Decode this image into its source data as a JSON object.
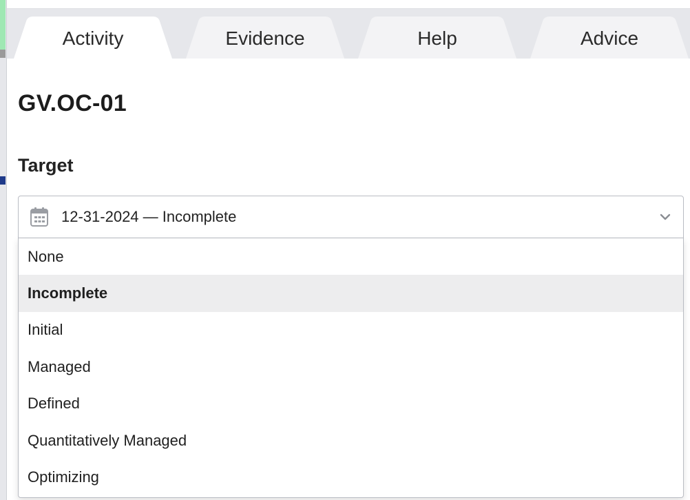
{
  "tabs": [
    {
      "label": "Activity",
      "active": true
    },
    {
      "label": "Evidence",
      "active": false
    },
    {
      "label": "Help",
      "active": false
    },
    {
      "label": "Advice",
      "active": false
    }
  ],
  "heading": "GV.OC-01",
  "target": {
    "label": "Target",
    "selected_value": "12-31-2024 — Incomplete",
    "options": [
      "None",
      "Incomplete",
      "Initial",
      "Managed",
      "Defined",
      "Quantitatively Managed",
      "Optimizing"
    ],
    "highlighted_option": "Incomplete"
  },
  "colors": {
    "tab_bg": "#e6e7eb",
    "active_tab_bg": "#ffffff",
    "option_highlight": "#ededee",
    "border": "#b9bcc3"
  },
  "icons": {
    "select_icon": "calendar-icon",
    "chevron": "chevron-down-icon"
  }
}
